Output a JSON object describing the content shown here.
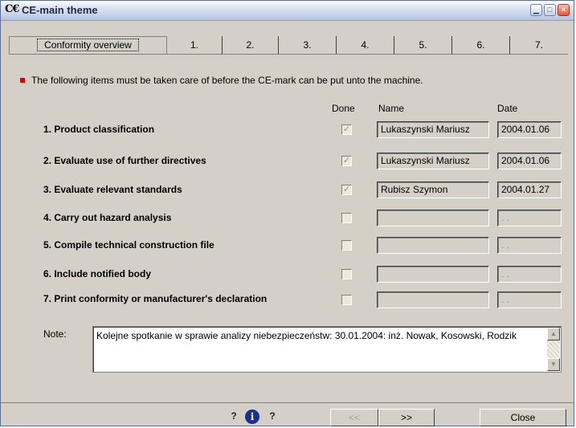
{
  "window": {
    "title": "CE-main theme",
    "icon": "ce-mark-icon"
  },
  "tabs": [
    {
      "label": "Conformity overview",
      "active": true
    },
    {
      "label": "1."
    },
    {
      "label": "2."
    },
    {
      "label": "3."
    },
    {
      "label": "4."
    },
    {
      "label": "5."
    },
    {
      "label": "6."
    },
    {
      "label": "7."
    }
  ],
  "intro": "The following items must be taken care of before the CE-mark can be put unto the machine.",
  "columns": {
    "done": "Done",
    "name": "Name",
    "date": "Date"
  },
  "items": [
    {
      "label": "1. Product classification",
      "done": true,
      "name": "Lukaszynski Mariusz",
      "date": "2004.01.06"
    },
    {
      "label": "2. Evaluate use of further directives",
      "done": true,
      "name": "Lukaszynski Mariusz",
      "date": "2004.01.06"
    },
    {
      "label": "3. Evaluate relevant standards",
      "done": true,
      "name": "Rubisz Szymon",
      "date": "2004.01.27"
    },
    {
      "label": "4. Carry out hazard analysis",
      "done": false,
      "name": "",
      "date": ". ."
    },
    {
      "label": "5. Compile technical construction file",
      "done": false,
      "name": "",
      "date": ". ."
    },
    {
      "label": "6. Include notified body",
      "done": false,
      "name": "",
      "date": ". ."
    },
    {
      "label": "7. Print conformity or manufacturer's declaration",
      "done": false,
      "name": "",
      "date": ". ."
    }
  ],
  "note": {
    "label": "Note:",
    "text": "Kolejne spotkanie w sprawie analizy niebezpieczeństw: 30.01.2004: inż. Nowak, Kosowski, Rodzik"
  },
  "footer": {
    "prev_label": "<<",
    "next_label": ">>",
    "close_label": "Close",
    "help_icon_text": "?",
    "info_icon_text": "i"
  },
  "colors": {
    "bullet": "#e00000",
    "face": "#d4d0c8"
  }
}
